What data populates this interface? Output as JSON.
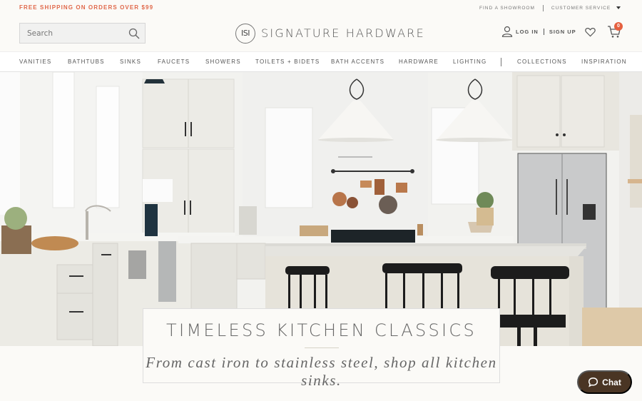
{
  "utility_bar": {
    "promo": "FREE SHIPPING ON ORDERS OVER $99",
    "find_showroom": "FIND A SHOWROOM",
    "customer_service": "CUSTOMER SERVICE",
    "promo_color": "#e0684a"
  },
  "header": {
    "search_placeholder": "Search",
    "logo_mark": "ISI",
    "logo_text": "SIGNATURE HARDWARE",
    "log_in": "LOG IN",
    "sign_up": "SIGN UP",
    "cart_count": "0",
    "badge_color": "#e5603f"
  },
  "nav": {
    "items": [
      {
        "label": "VANITIES"
      },
      {
        "label": "BATHTUBS"
      },
      {
        "label": "SINKS"
      },
      {
        "label": "FAUCETS"
      },
      {
        "label": "SHOWERS"
      },
      {
        "label": "TOILETS + BIDETS"
      },
      {
        "label": "BATH ACCENTS"
      },
      {
        "label": "HARDWARE"
      },
      {
        "label": "LIGHTING"
      },
      {
        "label": "COLLECTIONS"
      },
      {
        "label": "INSPIRATION"
      }
    ]
  },
  "hero": {
    "image_alt": "Bright white kitchen with island, black stools and pendant lights",
    "title": "TIMELESS KITCHEN CLASSICS",
    "subtitle": "From cast iron to stainless steel, shop all kitchen sinks."
  },
  "chat": {
    "label": "Chat",
    "color": "#4a3524"
  }
}
